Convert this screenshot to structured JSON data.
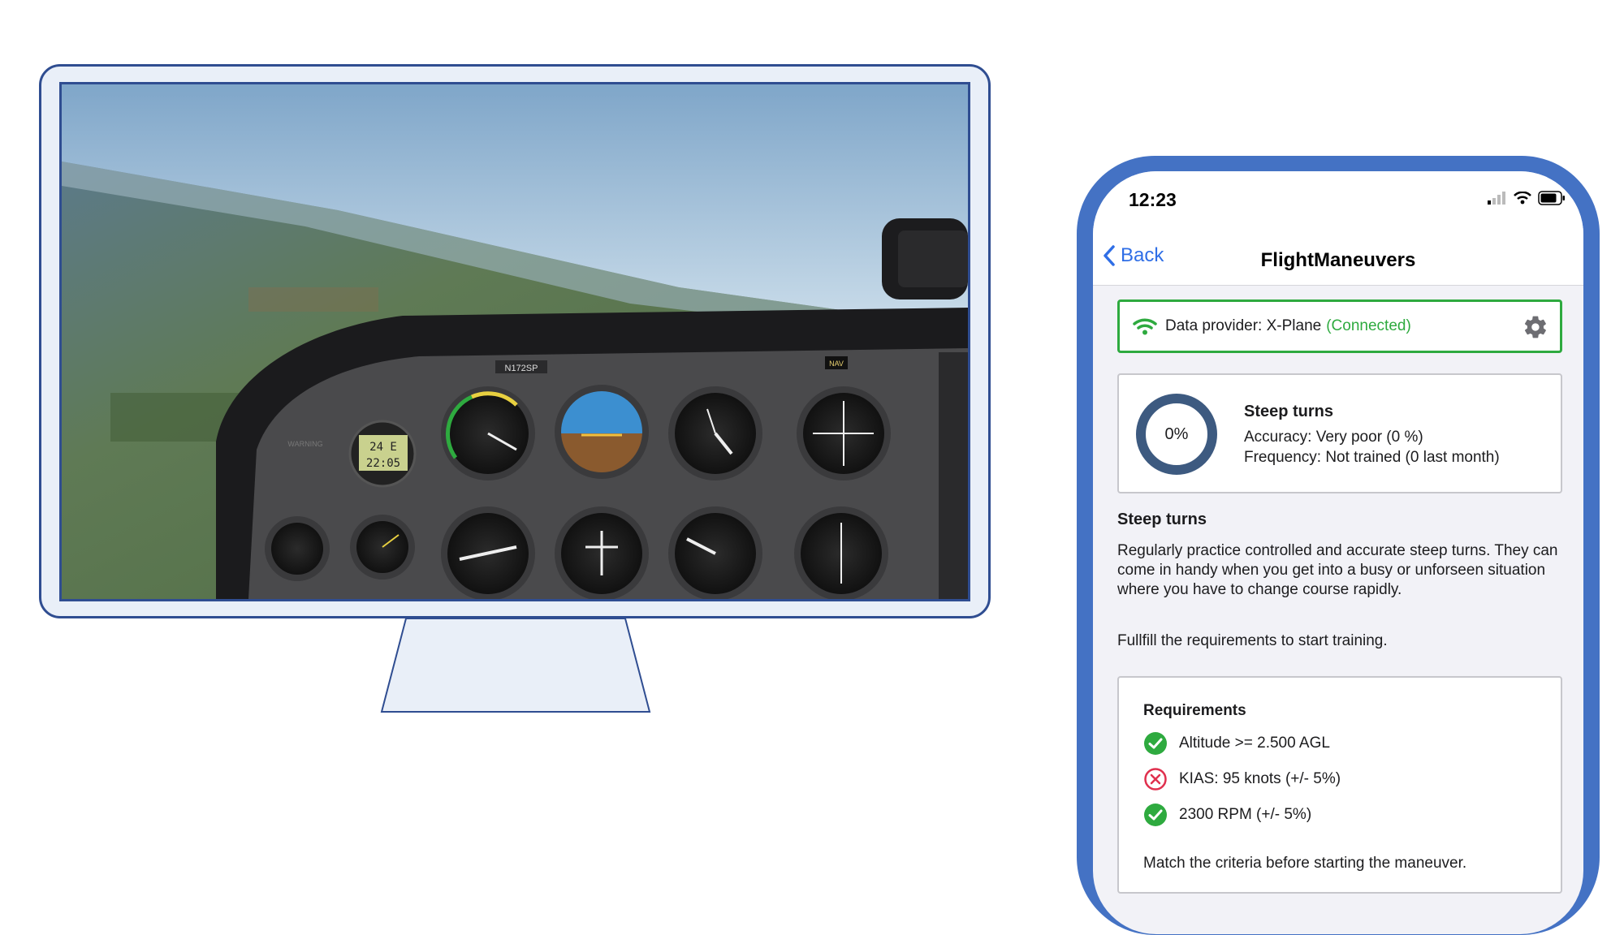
{
  "monitor": {
    "simulator_view": {
      "panel_tail_number": "N172SP",
      "clock_top": "24 E",
      "clock_bottom": "22:05",
      "nav_label": "NAV",
      "warning_label": "WARNING"
    }
  },
  "phone": {
    "status_bar": {
      "time": "12:23"
    },
    "nav": {
      "back_label": "Back",
      "title": "FlightManeuvers"
    },
    "provider": {
      "label": "Data provider: X-Plane",
      "status": "(Connected)",
      "status_color": "#2eaa3f"
    },
    "stats": {
      "progress_label": "0%",
      "progress_value": 0,
      "title": "Steep turns",
      "accuracy": "Accuracy: Very poor (0 %)",
      "frequency": "Frequency: Not trained (0 last month)"
    },
    "section_title": "Steep turns",
    "description": "Regularly practice controlled and accurate steep turns. They can come in handy when you get into a busy or unforseen situation where you have to change course rapidly.",
    "requirements_hint": "Fullfill the requirements to start training.",
    "requirements": {
      "title": "Requirements",
      "items": [
        {
          "label": "Altitude >= 2.500 AGL",
          "status": "ok"
        },
        {
          "label": "KIAS: 95 knots (+/- 5%)",
          "status": "fail"
        },
        {
          "label": "2300 RPM (+/- 5%)",
          "status": "ok"
        }
      ],
      "footer": "Match the criteria before starting the maneuver."
    },
    "colors": {
      "accent": "#2f6ee6",
      "ok": "#2eaa3f",
      "fail": "#e0304e",
      "ring": "#3d5a80",
      "frame": "#4472c4"
    }
  }
}
